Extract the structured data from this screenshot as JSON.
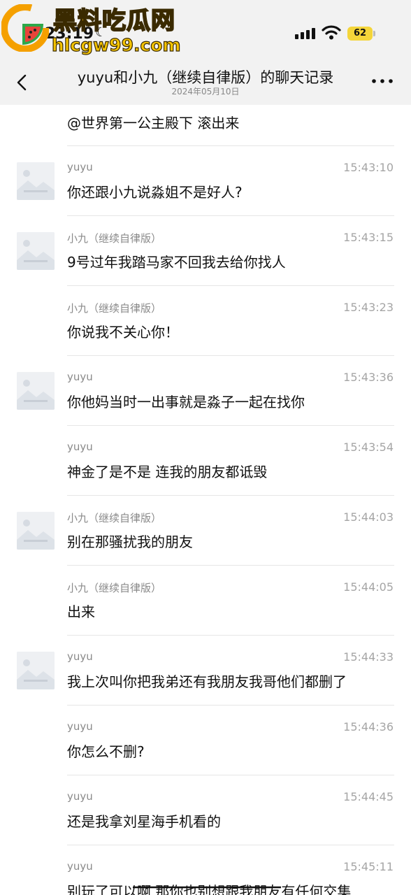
{
  "status_bar": {
    "time": "23:19",
    "battery": "62",
    "icons": [
      "moon-icon",
      "cellular-signal-icon",
      "wifi-icon",
      "battery-icon"
    ]
  },
  "watermark": {
    "title": "黑料吃瓜网",
    "url": "hlcgw99.com",
    "colors": {
      "text": "#f0b400",
      "outline": "#3a2a00",
      "logo_orange": "#f5a000"
    }
  },
  "header": {
    "title": "yuyu和小九（继续自律版）的聊天记录",
    "date": "2024年05月10日",
    "icons": [
      "back-chevron-icon",
      "more-icon"
    ]
  },
  "first_message": {
    "text": "@世界第一公主殿下 滚出来"
  },
  "messages": [
    {
      "sender": "yuyu",
      "time": "15:43:10",
      "text": "你还跟小九说淼姐不是好人?",
      "avatar": true
    },
    {
      "sender": "小九（继续自律版）",
      "time": "15:43:15",
      "text": "9号过年我踏马家不回我去给你找人",
      "avatar": true
    },
    {
      "sender": "小九（继续自律版）",
      "time": "15:43:23",
      "text": "你说我不关心你！",
      "avatar": false
    },
    {
      "sender": "yuyu",
      "time": "15:43:36",
      "text": "你他妈当时一出事就是淼子一起在找你",
      "avatar": true
    },
    {
      "sender": "yuyu",
      "time": "15:43:54",
      "text": "神金了是不是 连我的朋友都诋毁",
      "avatar": false
    },
    {
      "sender": "小九（继续自律版）",
      "time": "15:44:03",
      "text": "别在那骚扰我的朋友",
      "avatar": true
    },
    {
      "sender": "小九（继续自律版）",
      "time": "15:44:05",
      "text": "出来",
      "avatar": false
    },
    {
      "sender": "yuyu",
      "time": "15:44:33",
      "text": "我上次叫你把我弟还有我朋友我哥他们都删了",
      "avatar": true
    },
    {
      "sender": "yuyu",
      "time": "15:44:36",
      "text": "你怎么不删?",
      "avatar": false
    },
    {
      "sender": "yuyu",
      "time": "15:44:45",
      "text": "还是我拿刘星海手机看的",
      "avatar": false
    },
    {
      "sender": "yuyu",
      "time": "15:45:11",
      "text": "别玩了可以啊 那你也别想跟我朋友有任何交集",
      "avatar": false
    }
  ],
  "colors": {
    "header_bg": "#f2f2f2",
    "divider": "#e6e6e6",
    "meta_text": "#8a8a8a",
    "battery": "#f4d53a"
  }
}
